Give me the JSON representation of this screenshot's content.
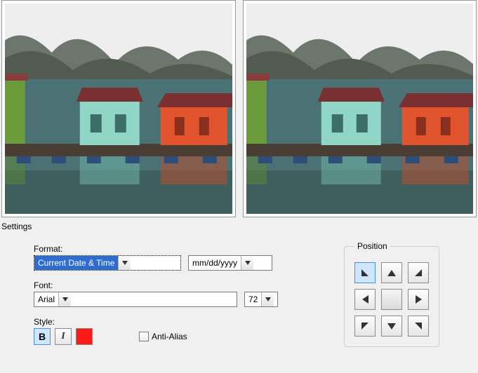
{
  "sections": {
    "settings_legend": "Settings",
    "position_legend": "Position"
  },
  "format": {
    "label": "Format:",
    "value": "Current Date & Time",
    "pattern": "mm/dd/yyyy"
  },
  "font": {
    "label": "Font:",
    "family": "Arial",
    "size": "72"
  },
  "style": {
    "label": "Style:",
    "bold_pressed": true,
    "italic_pressed": false,
    "color": "#ff1a1a",
    "anti_alias_label": "Anti-Alias",
    "anti_alias_checked": false
  },
  "position": {
    "selected": "top-left"
  }
}
